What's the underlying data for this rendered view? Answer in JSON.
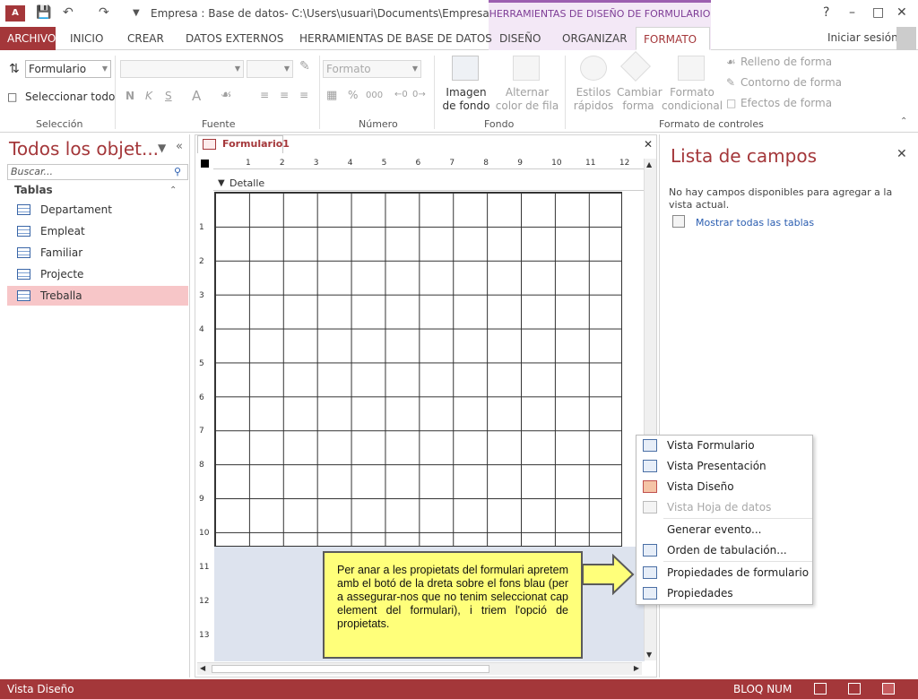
{
  "titlebar": {
    "app_icon": "A",
    "title": "Empresa : Base de datos- C:\\Users\\usuari\\Documents\\Empresa.acc...",
    "contextual": "HERRAMIENTAS DE DISEÑO DE FORMULARIO",
    "help": "?",
    "minimize": "–",
    "restore": "□",
    "close": "✕"
  },
  "tabs": {
    "file": "ARCHIVO",
    "items": [
      "INICIO",
      "CREAR",
      "DATOS EXTERNOS",
      "HERRAMIENTAS DE BASE DE DATOS",
      "DISEÑO",
      "ORGANIZAR",
      "FORMATO"
    ],
    "signin": "Iniciar sesión"
  },
  "ribbon": {
    "object_combo": "Formulario",
    "select_all": "Seleccionar todo",
    "bold": "N",
    "italic": "K",
    "underline": "S",
    "font_color": "A",
    "format_combo": "Formato",
    "percent": "%",
    "thousands": "000",
    "background_image": "Imagen de fondo",
    "alt_row_color": "Alternar color de fila",
    "quick_styles": "Estilos rápidos",
    "change_shape": "Cambiar forma",
    "conditional_format": "Formato condicional",
    "shape_fill": "Relleno de forma",
    "shape_outline": "Contorno de forma",
    "shape_effects": "Efectos de forma",
    "groups": {
      "selection": "Selección",
      "font": "Fuente",
      "number": "Número",
      "background": "Fondo",
      "control_format": "Formato de controles"
    }
  },
  "nav": {
    "header": "Todos los objet...",
    "search_placeholder": "Buscar...",
    "section": "Tablas",
    "items": [
      {
        "label": "Departament"
      },
      {
        "label": "Empleat"
      },
      {
        "label": "Familiar"
      },
      {
        "label": "Projecte"
      },
      {
        "label": "Treballa"
      }
    ]
  },
  "doc": {
    "tab": "Formulario1",
    "close": "✕",
    "detail": "Detalle",
    "ruler_top": [
      "1",
      "2",
      "3",
      "4",
      "5",
      "6",
      "7",
      "8",
      "9",
      "10",
      "11",
      "12"
    ],
    "ruler_left": [
      "1",
      "2",
      "3",
      "4",
      "5",
      "6",
      "7",
      "8",
      "9",
      "10",
      "11",
      "12",
      "13"
    ]
  },
  "fieldlist": {
    "header": "Lista de campos",
    "close": "✕",
    "message": "No hay campos disponibles para agregar a la vista actual.",
    "link": "Mostrar todas las tablas"
  },
  "context_menu": {
    "items": [
      {
        "label": "Vista Formulario",
        "disabled": false
      },
      {
        "label": "Vista Presentación",
        "disabled": false
      },
      {
        "label": "Vista Diseño",
        "disabled": false
      },
      {
        "label": "Vista Hoja de datos",
        "disabled": true
      },
      {
        "label": "Generar evento...",
        "disabled": false
      },
      {
        "label": "Orden de tabulación...",
        "disabled": false
      },
      {
        "label": "Propiedades de formulario",
        "disabled": false
      },
      {
        "label": "Propiedades",
        "disabled": false
      }
    ]
  },
  "callout": {
    "text": "Per anar a les propietats del formulari apretem amb el botó de la dreta sobre el fons blau (per a assegurar-nos que no tenim seleccionat cap element del formulari), i triem l'opció de propietats."
  },
  "status": {
    "left": "Vista Diseño",
    "numlock": "BLOQ NUM"
  },
  "colors": {
    "accent": "#a4373a",
    "contextual": "#7e3d96",
    "callout": "#ffff7a",
    "selected": "#f7c6c8"
  }
}
